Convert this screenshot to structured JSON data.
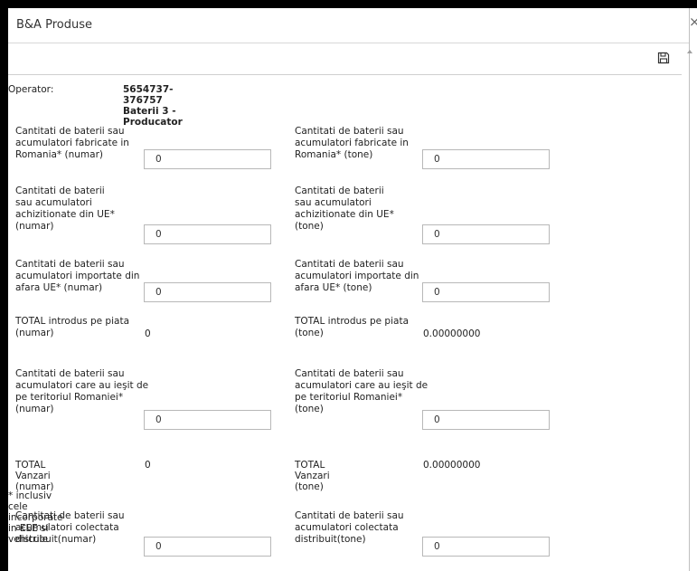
{
  "dialog": {
    "title": "B&A Produse",
    "close_glyph": "×",
    "save_icon": "floppy-disk-icon"
  },
  "operator": {
    "label": "Operator:",
    "value": "5654737-376757 Baterii 3 - Producator"
  },
  "fields": {
    "fab_numar": {
      "label": "Cantitati de baterii sau acumulatori fabricate in Romania* (numar)",
      "value": "0"
    },
    "fab_tone": {
      "label": "Cantitati de baterii sau acumulatori fabricate in Romania* (tone)",
      "value": "0"
    },
    "ue_numar": {
      "label": "Cantitati de baterii sau acumulatori achizitionate din UE* (numar)",
      "value": "0"
    },
    "ue_tone": {
      "label": "Cantitati de baterii sau acumulatori achizitionate din UE* (tone)",
      "value": "0"
    },
    "imp_numar": {
      "label": "Cantitati de baterii sau acumulatori importate din afara UE* (numar)",
      "value": "0"
    },
    "imp_tone": {
      "label": "Cantitati de baterii sau acumulatori importate din afara UE* (tone)",
      "value": "0"
    },
    "iesit_numar": {
      "label": "Cantitati de baterii sau acumulatori care au ieşit de pe teritoriul Romaniei* (numar)",
      "value": "0"
    },
    "iesit_tone": {
      "label": "Cantitati de baterii sau acumulatori care au ieşit de pe teritoriul Romaniei* (tone)",
      "value": "0"
    },
    "col_numar": {
      "label": "Cantitati de baterii sau acumulatori colectata distribuit(numar)",
      "value": "0"
    },
    "col_tone": {
      "label": "Cantitati de baterii sau acumulatori colectata distribuit(tone)",
      "value": "0"
    }
  },
  "totals": {
    "piata_numar": {
      "label": "TOTAL introdus pe piata (numar)",
      "value": "0"
    },
    "piata_tone": {
      "label": "TOTAL introdus pe piata (tone)",
      "value": "0.00000000"
    },
    "vanzari_numar": {
      "label": "TOTAL Vanzari (numar)",
      "value": "0"
    },
    "vanzari_tone": {
      "label": "TOTAL Vanzari (tone)",
      "value": "0.00000000"
    }
  },
  "note": "* inclusiv cele incorporate in EEE si vehicule"
}
